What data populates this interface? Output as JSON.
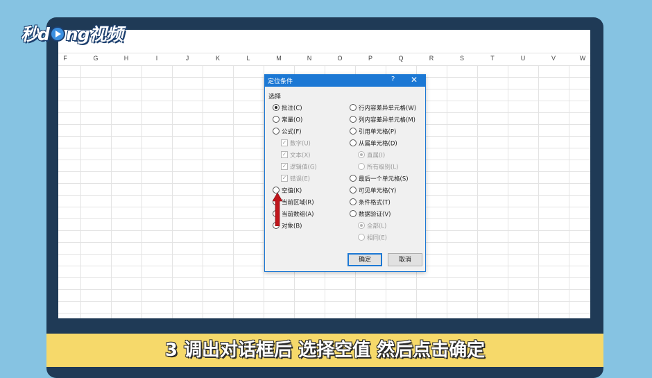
{
  "brand": {
    "logo_prefix": "秒d",
    "logo_suffix": "ng视频"
  },
  "sheet": {
    "columns": [
      "F",
      "G",
      "H",
      "I",
      "J",
      "K",
      "L",
      "M",
      "N",
      "O",
      "P",
      "Q",
      "R",
      "S",
      "T",
      "U",
      "V",
      "W"
    ]
  },
  "dialog": {
    "title": "定位条件",
    "help_label": "?",
    "close_label": "✕",
    "group_label": "选择",
    "left_options": [
      {
        "label": "批注(C)",
        "checked": true
      },
      {
        "label": "常量(O)",
        "checked": false
      },
      {
        "label": "公式(F)",
        "checked": false
      }
    ],
    "formula_sub": [
      {
        "label": "数字(U)"
      },
      {
        "label": "文本(X)"
      },
      {
        "label": "逻辑值(G)"
      },
      {
        "label": "错误(E)"
      }
    ],
    "left_options_2": [
      {
        "label": "空值(K)"
      },
      {
        "label": "当前区域(R)"
      },
      {
        "label": "当前数组(A)"
      },
      {
        "label": "对象(B)"
      }
    ],
    "right_options": [
      {
        "label": "行内容差异单元格(W)"
      },
      {
        "label": "列内容差异单元格(M)"
      },
      {
        "label": "引用单元格(P)"
      },
      {
        "label": "从属单元格(D)"
      }
    ],
    "dependents_sub": [
      {
        "label": "直属(I)"
      },
      {
        "label": "所有级别(L)"
      }
    ],
    "right_options_2": [
      {
        "label": "最后一个单元格(S)"
      },
      {
        "label": "可见单元格(Y)"
      },
      {
        "label": "条件格式(T)"
      },
      {
        "label": "数据验证(V)"
      }
    ],
    "validation_sub": [
      {
        "label": "全部(L)"
      },
      {
        "label": "相同(E)"
      }
    ],
    "ok_label": "确定",
    "cancel_label": "取消"
  },
  "caption": "3 调出对话框后 选择空值 然后点击确定",
  "colors": {
    "accent": "#1c78d4",
    "caption_bar": "#f6d96a",
    "background": "#86c3e2",
    "arrow": "#c0161c"
  }
}
